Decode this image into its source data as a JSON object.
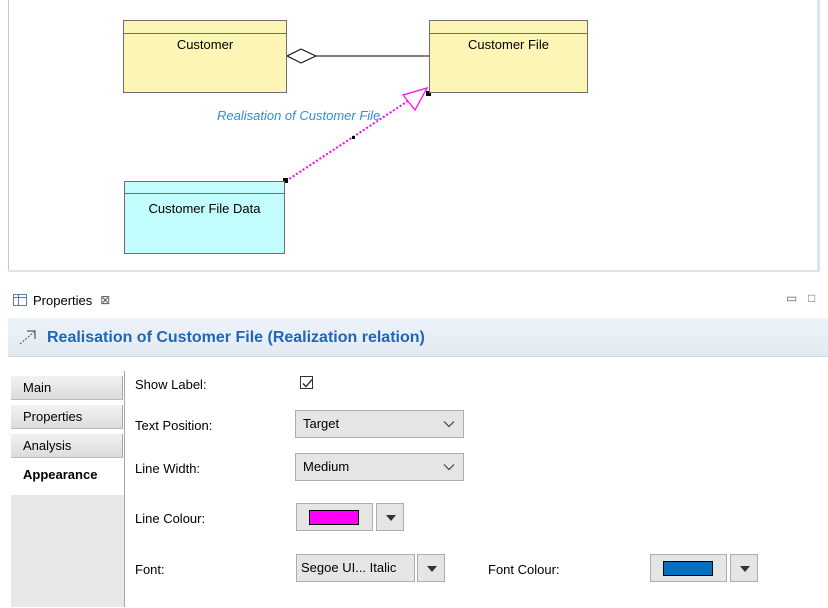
{
  "diagram": {
    "classes": {
      "customer": "Customer",
      "customer_file": "Customer File",
      "customer_file_data": "Customer File Data"
    },
    "relation_label": "Realisation of Customer File",
    "colors": {
      "class_fill": "#fdf5b5",
      "data_fill": "#c3fcfc",
      "realization_line": "#ff00ff",
      "label_color": "#2f8fd0"
    }
  },
  "properties_view": {
    "tab_label": "Properties",
    "close_glyph": "⊠",
    "minimize_glyph": "▭",
    "maximize_glyph": "□",
    "title": "Realisation of Customer File (Realization relation)",
    "side_tabs": [
      "Main",
      "Properties",
      "Analysis",
      "Appearance"
    ],
    "active_tab": "Appearance",
    "form": {
      "show_label": {
        "label": "Show Label:",
        "checked": true
      },
      "text_position": {
        "label": "Text Position:",
        "value": "Target"
      },
      "line_width": {
        "label": "Line Width:",
        "value": "Medium"
      },
      "line_colour": {
        "label": "Line Colour:",
        "value": "#ff00ff"
      },
      "font": {
        "label": "Font:",
        "value": "Segoe UI... Italic"
      },
      "font_colour": {
        "label": "Font Colour:",
        "value": "#0070c0"
      }
    }
  },
  "icons": [
    "properties-view-icon",
    "close-tab-icon",
    "minimize-icon",
    "maximize-icon",
    "relation-arrow-icon",
    "checkmark-icon",
    "chevron-down-icon",
    "dropdown-triangle-icon"
  ]
}
